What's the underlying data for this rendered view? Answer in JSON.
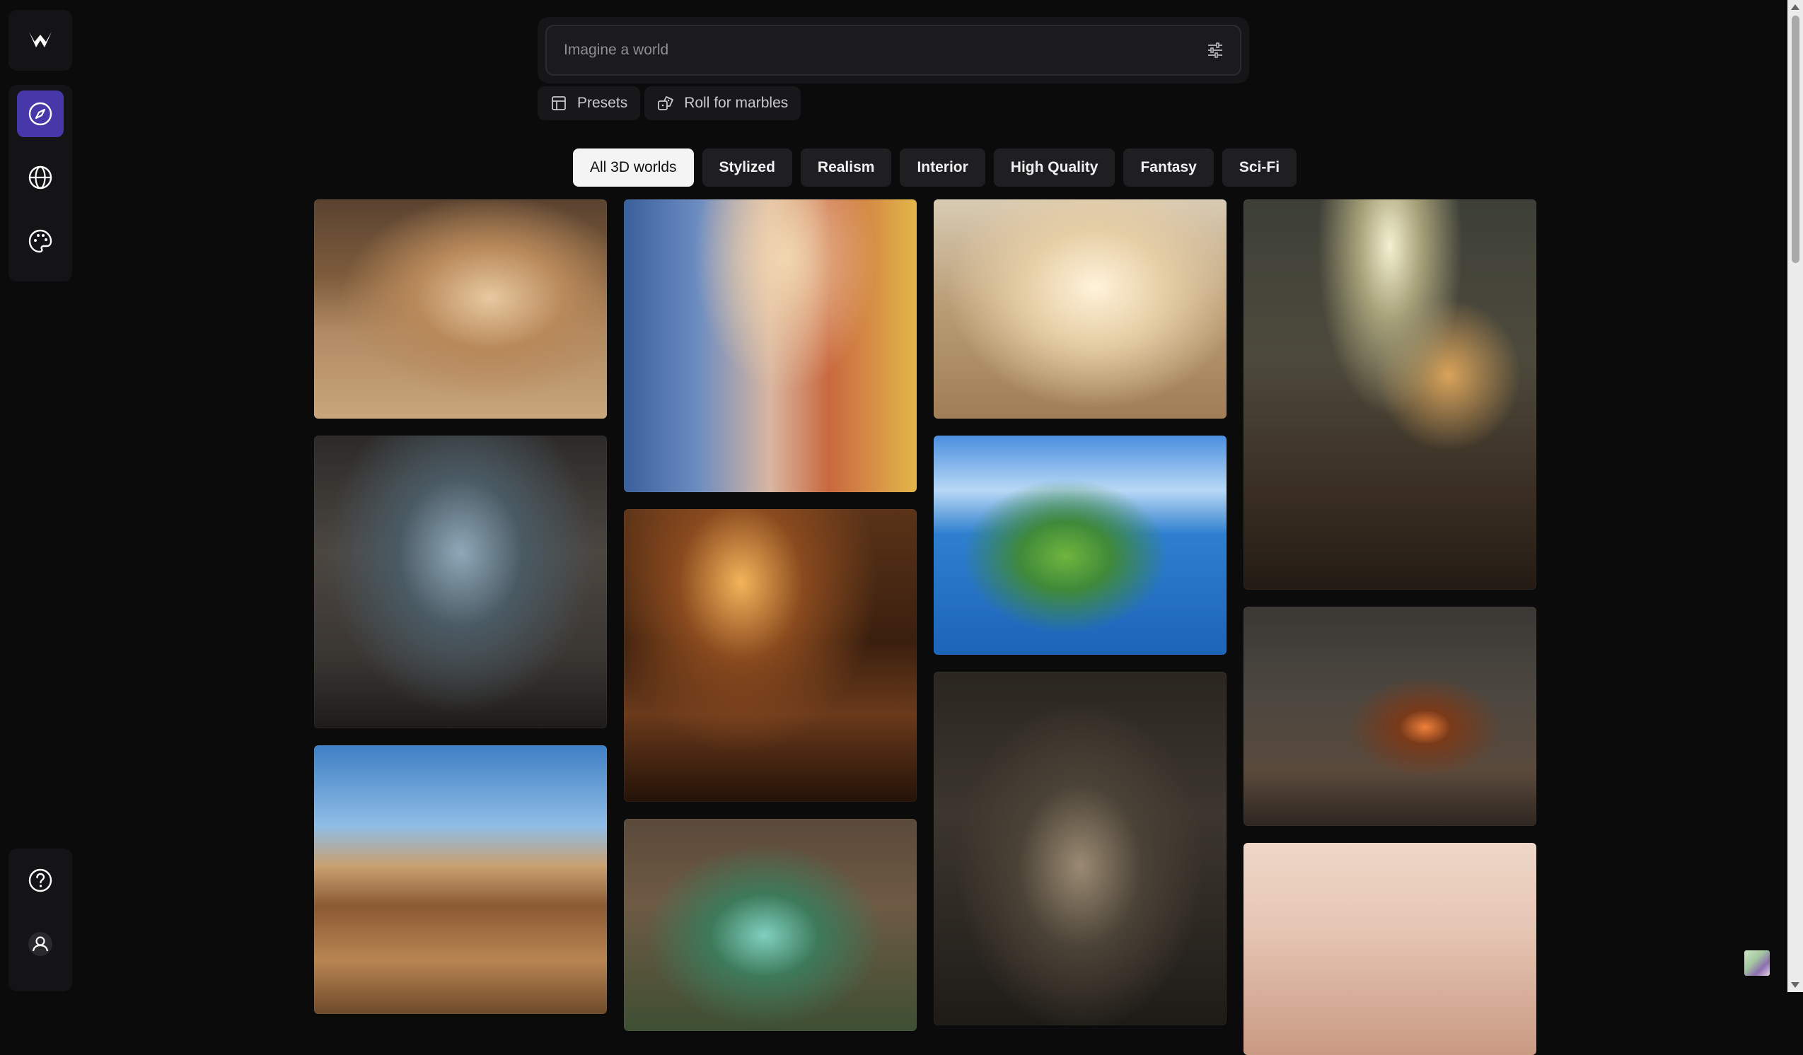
{
  "search": {
    "placeholder": "Imagine a world"
  },
  "chips": [
    {
      "label": "Presets",
      "icon": "layout-icon"
    },
    {
      "label": "Roll for marbles",
      "icon": "dice-icon"
    }
  ],
  "categories": [
    {
      "label": "All 3D worlds",
      "active": true
    },
    {
      "label": "Stylized",
      "active": false
    },
    {
      "label": "Realism",
      "active": false
    },
    {
      "label": "Interior",
      "active": false
    },
    {
      "label": "High Quality",
      "active": false
    },
    {
      "label": "Fantasy",
      "active": false
    },
    {
      "label": "Sci-Fi",
      "active": false
    }
  ],
  "sidebar": {
    "nav": [
      "compass-icon",
      "globe-icon",
      "palette-icon"
    ],
    "active": "compass-icon",
    "bottom": [
      "help-icon",
      "user-icon"
    ]
  },
  "colors": {
    "accent": "#4638a8",
    "background": "#0b0b0c",
    "chip_active": "#f4f4f5"
  }
}
